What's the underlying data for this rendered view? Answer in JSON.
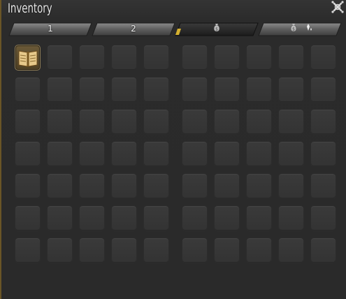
{
  "window": {
    "title": "Inventory"
  },
  "tabs": [
    {
      "label": "1",
      "active": false,
      "icon": null
    },
    {
      "label": "2",
      "active": false,
      "icon": null
    },
    {
      "label": "",
      "active": true,
      "icon": "money-bag-icon"
    },
    {
      "label": "",
      "active": false,
      "icon": "money-bag-sparkle-icon"
    }
  ],
  "grid": {
    "rows": 7,
    "columns_per_block": 5,
    "blocks": 2,
    "filled_slots": [
      {
        "block": 0,
        "row": 0,
        "col": 0,
        "item_icon": "open-book-icon"
      }
    ]
  },
  "colors": {
    "background": "#2a2a2a",
    "slot": "#363636",
    "tab_active_accent": "#d4b030",
    "border_accent": "#6a5526"
  }
}
